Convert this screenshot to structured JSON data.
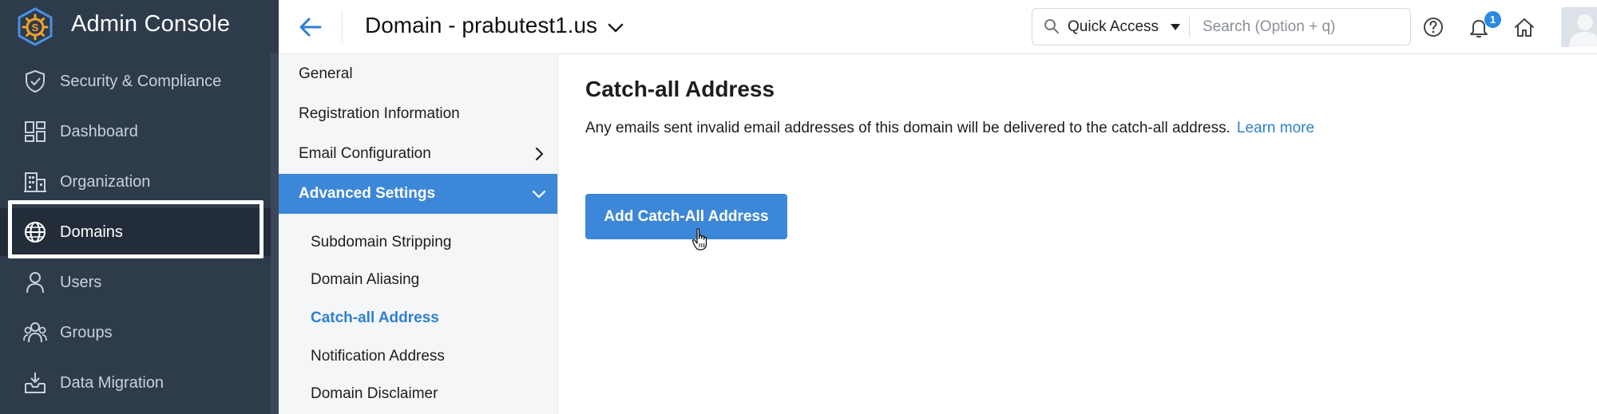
{
  "app": {
    "title": "Admin Console"
  },
  "sidebar": {
    "items": [
      {
        "label": "Security & Compliance",
        "icon": "shield-check-icon"
      },
      {
        "label": "Dashboard",
        "icon": "dashboard-grid-icon"
      },
      {
        "label": "Organization",
        "icon": "building-icon"
      },
      {
        "label": "Domains",
        "icon": "globe-icon",
        "active": true
      },
      {
        "label": "Users",
        "icon": "user-icon"
      },
      {
        "label": "Groups",
        "icon": "group-icon"
      },
      {
        "label": "Data Migration",
        "icon": "inbox-download-icon"
      }
    ]
  },
  "header": {
    "title": "Domain - prabutest1.us",
    "quick_access_label": "Quick Access",
    "search_placeholder": "Search (Option + q)",
    "notification_count": "1"
  },
  "subnav": {
    "items": [
      {
        "label": "General"
      },
      {
        "label": "Registration Information"
      },
      {
        "label": "Email Configuration"
      },
      {
        "label": "Advanced Settings",
        "expanded": true
      }
    ],
    "children": [
      {
        "label": "Subdomain Stripping"
      },
      {
        "label": "Domain Aliasing"
      },
      {
        "label": "Catch-all Address",
        "current": true
      },
      {
        "label": "Notification Address"
      },
      {
        "label": "Domain Disclaimer"
      }
    ]
  },
  "main": {
    "title": "Catch-all Address",
    "description": "Any emails sent invalid email addresses of this domain will be delivered to the catch-all address.",
    "learn_more": "Learn more",
    "button_label": "Add Catch-All Address"
  },
  "colors": {
    "sidebar_bg": "#2e3b4b",
    "sidebar_active_bg": "#232d39",
    "accent": "#3d87d8",
    "link": "#2d80d2",
    "logo_orange": "#f0a22b"
  }
}
